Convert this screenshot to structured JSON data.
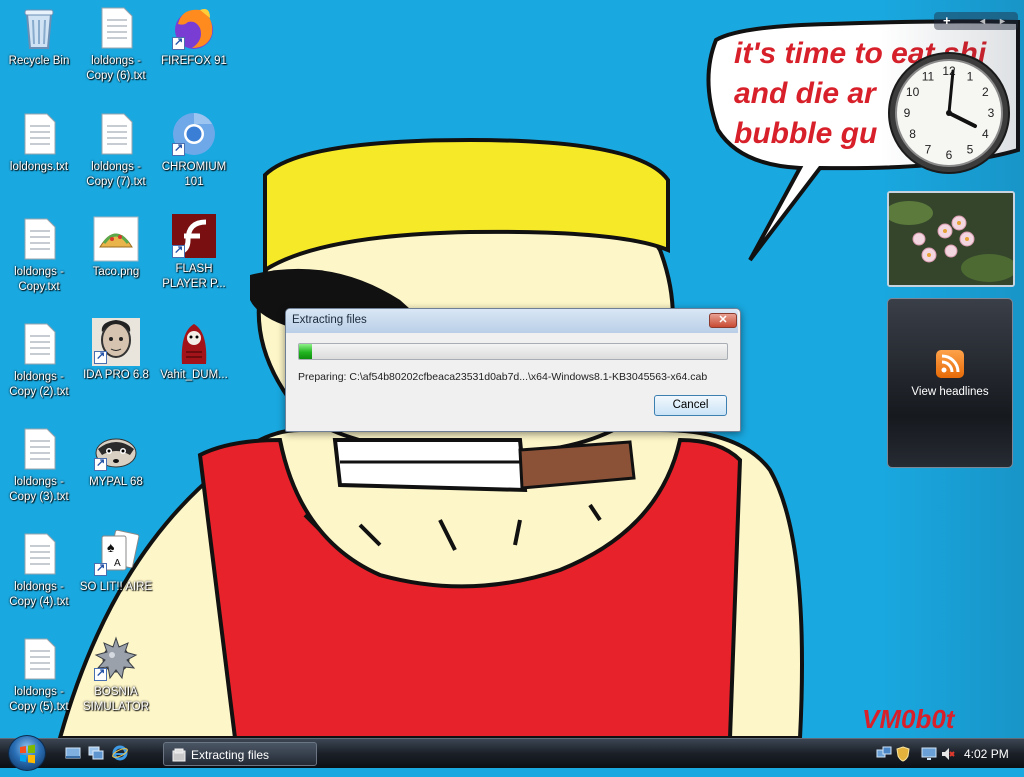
{
  "desktop_icons": [
    {
      "label": "Recycle Bin",
      "icon": "recycle-bin-icon"
    },
    {
      "label": "loldongs - Copy (6).txt",
      "icon": "text-file-icon"
    },
    {
      "label": "FIREFOX 91",
      "icon": "firefox-icon"
    },
    {
      "label": "loldongs.txt",
      "icon": "text-file-icon"
    },
    {
      "label": "loldongs - Copy (7).txt",
      "icon": "text-file-icon"
    },
    {
      "label": "CHROMIUM 101",
      "icon": "chromium-icon"
    },
    {
      "label": "loldongs - Copy.txt",
      "icon": "text-file-icon"
    },
    {
      "label": "Taco.png",
      "icon": "taco-image-icon"
    },
    {
      "label": "FLASH PLAYER P...",
      "icon": "flash-player-icon"
    },
    {
      "label": "loldongs - Copy (2).txt",
      "icon": "text-file-icon"
    },
    {
      "label": "IDA PRO 6.8",
      "icon": "ida-pro-icon"
    },
    {
      "label": "Vahit_DUM...",
      "icon": "vahit-icon"
    },
    {
      "label": "loldongs - Copy (3).txt",
      "icon": "text-file-icon"
    },
    {
      "label": "MYPAL 68",
      "icon": "mypal-icon"
    },
    {
      "label": "loldongs - Copy (4).txt",
      "icon": "text-file-icon"
    },
    {
      "label": "SO LIT!! AIRE",
      "icon": "solitaire-icon"
    },
    {
      "label": "loldongs - Copy (5).txt",
      "icon": "text-file-icon"
    },
    {
      "label": "BOSNIA SIMULATOR",
      "icon": "bosnia-simulator-icon"
    }
  ],
  "wallpaper": {
    "speech_lines": [
      "it's time to eat shi",
      "and die ar",
      "bubble gu"
    ],
    "watermark": "VM0b0t",
    "colors": {
      "background": "#19a8e0",
      "hat": "#f6e928",
      "shirt": "#e8222a",
      "skin": "#fdf6c8",
      "text": "#d8202a"
    }
  },
  "gadgets": {
    "toolbar_add": "+",
    "toolbar_prev": "◄",
    "toolbar_next": "►",
    "feeds_label": "View headlines",
    "clock_numbers": [
      "12",
      "1",
      "2",
      "3",
      "4",
      "5",
      "6",
      "7",
      "8",
      "9",
      "10",
      "11"
    ]
  },
  "dialog": {
    "title": "Extracting files",
    "close_glyph": "✕",
    "progress": 0.03,
    "status": "Preparing: C:\\af54b80202cfbeaca23531d0ab7d...\\x64-Windows8.1-KB3045563-x64.cab",
    "cancel_label": "Cancel"
  },
  "taskbar": {
    "active_window": "Extracting files",
    "time": "4:02 PM"
  }
}
